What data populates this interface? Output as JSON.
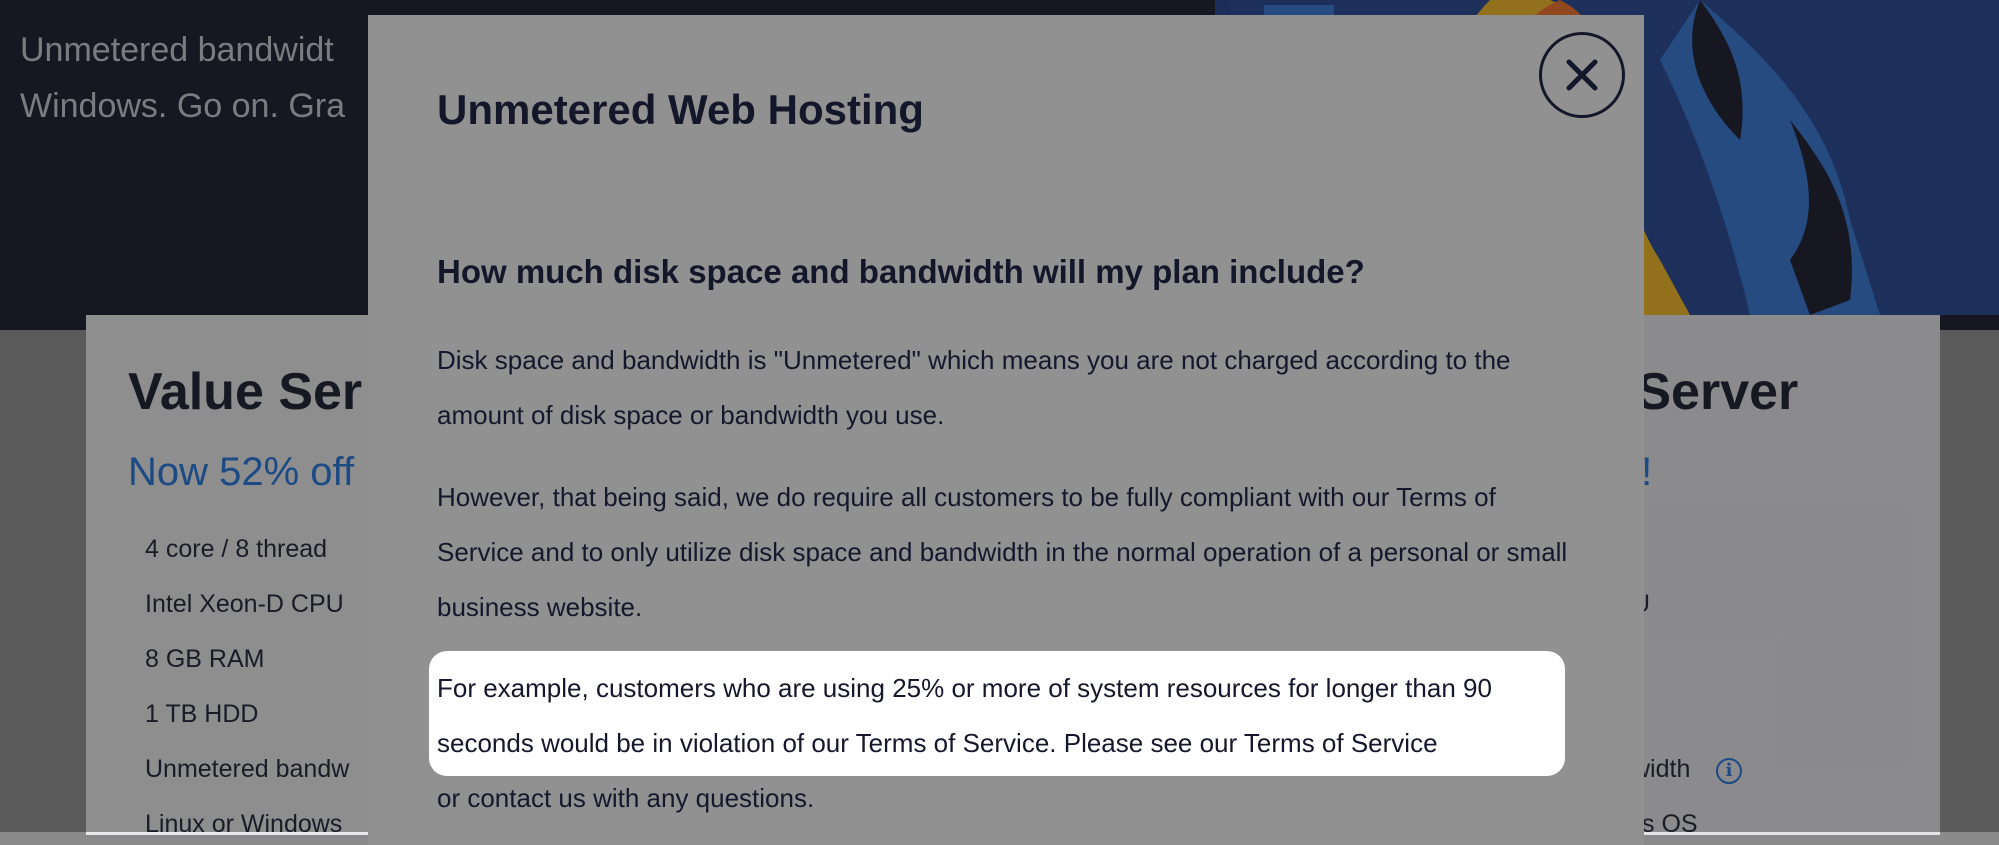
{
  "hero": {
    "line1": "Unmetered bandwidt",
    "line2": "Windows. Go on. Gra"
  },
  "cards": {
    "left": {
      "title": "Value Ser",
      "promo": "Now 52% off",
      "specs": [
        "4 core / 8 thread",
        "Intel Xeon-D CPU",
        "8 GB RAM",
        "1 TB HDD",
        "Unmetered bandw",
        "Linux or Windows"
      ]
    },
    "right": {
      "title": "e Server",
      "promo": "f!",
      "specs": [
        "U",
        "width",
        "s OS"
      ]
    }
  },
  "modal": {
    "title": "Unmetered Web Hosting",
    "question": "How much disk space and bandwidth will my plan include?",
    "para1": "Disk space and bandwidth is \"Unmetered\" which means you are not charged according to the amount of disk space or bandwidth you use.",
    "para2": "However, that being said, we do require all customers to be fully compliant with our Terms of Service and to only utilize disk space and bandwidth in the normal operation of a personal or small business website.",
    "para3_highlight": "For example, customers who are using 25% or more of system resources for longer than 90 seconds would be in violation of our Terms of Service. Please see our Terms of Service",
    "para3_rest": "or contact us with any questions.",
    "close_icon": "close-icon"
  },
  "colors": {
    "navy": "#14172a",
    "accent_blue": "#1a6ed8",
    "highlight": "#ffffff"
  }
}
